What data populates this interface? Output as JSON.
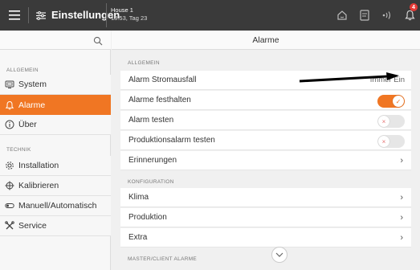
{
  "topbar": {
    "title": "Einstellungen",
    "house_name": "House 1",
    "house_time": "18:53, Tag 23",
    "notification_count": "4"
  },
  "sidebar": {
    "section_allgemein": "ALLGEMEIN",
    "section_technik": "TECHNIK",
    "items": [
      {
        "label": "System",
        "icon": "monitor-icon"
      },
      {
        "label": "Alarme",
        "icon": "bell-icon",
        "active": true
      },
      {
        "label": "Über",
        "icon": "info-icon"
      },
      {
        "label": "Installation",
        "icon": "gear-icon"
      },
      {
        "label": "Kalibrieren",
        "icon": "crosshair-icon"
      },
      {
        "label": "Manuell/Automatisch",
        "icon": "switch-icon"
      },
      {
        "label": "Service",
        "icon": "tools-icon"
      }
    ]
  },
  "main": {
    "title": "Alarme",
    "section_allgemein": "ALLGEMEIN",
    "section_konfiguration": "KONFIGURATION",
    "section_master": "MASTER/CLIENT ALARME",
    "rows": [
      {
        "label": "Alarm Stromausfall",
        "value": "Immer Ein"
      },
      {
        "label": "Alarme festhalten",
        "toggle": "on"
      },
      {
        "label": "Alarm testen",
        "toggle": "off"
      },
      {
        "label": "Produktionsalarm testen",
        "toggle": "off"
      },
      {
        "label": "Erinnerungen",
        "chevron": "›"
      }
    ],
    "config_rows": [
      {
        "label": "Klima",
        "chevron": "›"
      },
      {
        "label": "Produktion",
        "chevron": "›"
      },
      {
        "label": "Extra",
        "chevron": "›"
      }
    ]
  },
  "colors": {
    "accent": "#f07623",
    "topbar": "#3a3a3a",
    "badge": "#e53935"
  }
}
